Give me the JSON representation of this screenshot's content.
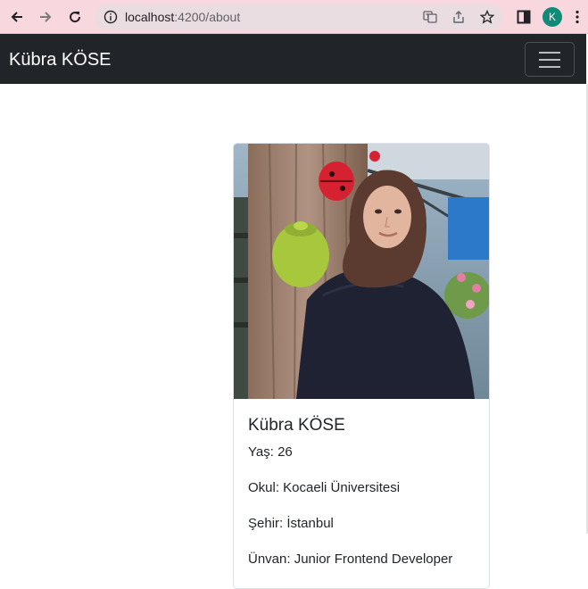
{
  "browser": {
    "url_host": "localhost",
    "url_path": ":4200/about",
    "profile_initial": "K"
  },
  "navbar": {
    "brand": "Kübra KÖSE",
    "menu_icon": "hamburger-icon",
    "background": "#212529"
  },
  "profile_card": {
    "name": "Kübra KÖSE",
    "age": "Yaş: 26",
    "school": "Okul: Kocaeli Üniversitesi",
    "city": "Şehir: İstanbul",
    "title": "Ünvan: Junior Frontend Developer"
  },
  "colors": {
    "browser_bar": "#f8d7de",
    "avatar": "#0f8b77"
  }
}
